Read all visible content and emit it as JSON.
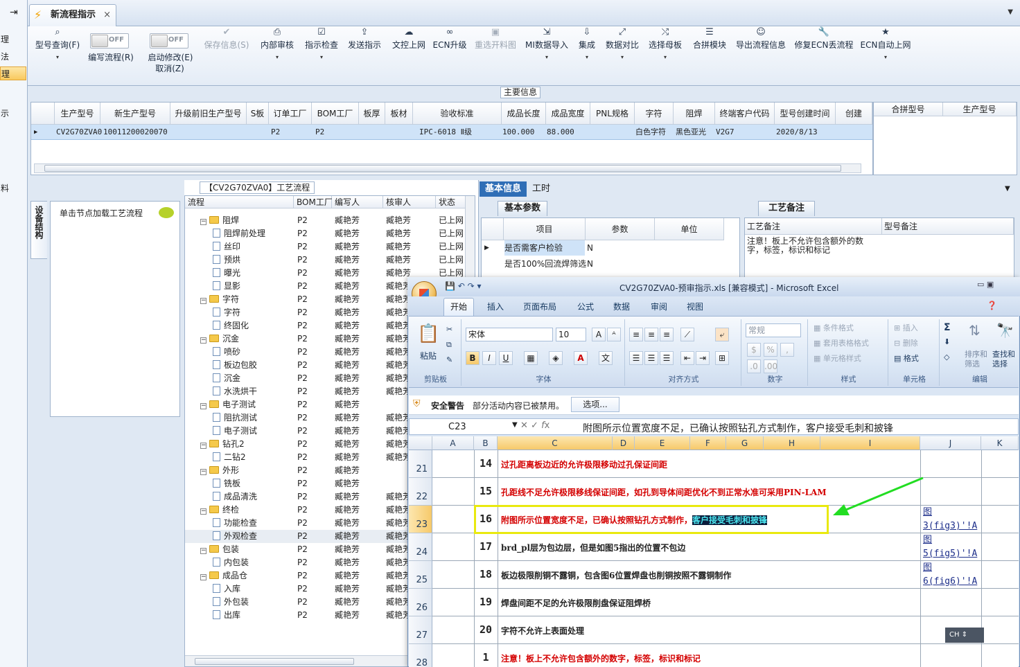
{
  "left_panel": {
    "items": [
      "理",
      "法",
      "理",
      "示",
      "料"
    ]
  },
  "tabbar": {
    "tab_title": "新流程指示",
    "close": "×"
  },
  "toolbar": {
    "items": [
      {
        "label": "型号查询(F)",
        "icon": "search-icon"
      },
      {
        "label": "编写流程(R)",
        "icon": "toggle"
      },
      {
        "label": "启动修改(E)",
        "icon": "toggle"
      },
      {
        "label": "取消(Z)",
        "icon": ""
      },
      {
        "label": "保存信息(S)",
        "icon": "check-icon"
      },
      {
        "label": "内部审核",
        "icon": "printer-icon"
      },
      {
        "label": "指示检查",
        "icon": "checkbox-icon"
      },
      {
        "label": "发送指示",
        "icon": "upload-icon"
      },
      {
        "label": "文控上网",
        "icon": "cloud-upload-icon"
      },
      {
        "label": "ECN升级",
        "icon": "binoculars-icon"
      },
      {
        "label": "重选开料图",
        "icon": "image-icon"
      },
      {
        "label": "MI数据导入",
        "icon": "import-icon"
      },
      {
        "label": "集成",
        "icon": "download-icon"
      },
      {
        "label": "数据对比",
        "icon": "compare-icon"
      },
      {
        "label": "选择母板",
        "icon": "shuffle-icon"
      },
      {
        "label": "合拼模块",
        "icon": "list-icon"
      },
      {
        "label": "导出流程信息",
        "icon": "smile-icon"
      },
      {
        "label": "修复ECN丢流程",
        "icon": "wrench-icon"
      },
      {
        "label": "ECN自动上网",
        "icon": "star-icon"
      }
    ],
    "toggle_text": "OFF"
  },
  "main_info": {
    "title": "主要信息",
    "columns": [
      "生产型号",
      "新生产型号",
      "升级前旧生产型号",
      "S板",
      "订单工厂",
      "BOM工厂",
      "板厚",
      "板材",
      "验收标准",
      "成品长度",
      "成品宽度",
      "PNL规格",
      "字符",
      "阻焊",
      "终端客户代码",
      "型号创建时间",
      "创建"
    ],
    "row": [
      "CV2G70ZVA0",
      "10011200020070",
      "",
      "",
      "P2",
      "P2",
      "",
      "",
      "IPC-6018 Ⅱ级",
      "100.000",
      "88.000",
      "",
      "白色字符",
      "黑色亚光",
      "V2G7",
      "2020/8/13",
      ""
    ],
    "side_columns": [
      "合拼型号",
      "生产型号"
    ]
  },
  "left_lower": {
    "vertical_tab": "设备结构",
    "hint": "单击节点加载工艺流程"
  },
  "process_tree": {
    "title": "【CV2G70ZVA0】工艺流程",
    "columns": [
      "流程",
      "BOM工厂",
      "编写人",
      "核审人",
      "状态"
    ],
    "rows": [
      {
        "name": "阻焊",
        "level": 0,
        "bom": "P2",
        "writer": "臧艳芳",
        "checker": "臧艳芳",
        "status": "已上网"
      },
      {
        "name": "阻焊前处理",
        "level": 1,
        "bom": "P2",
        "writer": "臧艳芳",
        "checker": "臧艳芳",
        "status": "已上网"
      },
      {
        "name": "丝印",
        "level": 1,
        "bom": "P2",
        "writer": "臧艳芳",
        "checker": "臧艳芳",
        "status": "已上网"
      },
      {
        "name": "预烘",
        "level": 1,
        "bom": "P2",
        "writer": "臧艳芳",
        "checker": "臧艳芳",
        "status": "已上网"
      },
      {
        "name": "曝光",
        "level": 1,
        "bom": "P2",
        "writer": "臧艳芳",
        "checker": "臧艳芳",
        "status": "已上网"
      },
      {
        "name": "显影",
        "level": 1,
        "bom": "P2",
        "writer": "臧艳芳",
        "checker": "臧艳芳",
        "status": ""
      },
      {
        "name": "字符",
        "level": 0,
        "bom": "P2",
        "writer": "臧艳芳",
        "checker": "臧艳芳",
        "status": ""
      },
      {
        "name": "字符",
        "level": 1,
        "bom": "P2",
        "writer": "臧艳芳",
        "checker": "臧艳芳",
        "status": ""
      },
      {
        "name": "终固化",
        "level": 1,
        "bom": "P2",
        "writer": "臧艳芳",
        "checker": "臧艳芳",
        "status": ""
      },
      {
        "name": "沉金",
        "level": 0,
        "bom": "P2",
        "writer": "臧艳芳",
        "checker": "臧艳芳",
        "status": ""
      },
      {
        "name": "喷砂",
        "level": 1,
        "bom": "P2",
        "writer": "臧艳芳",
        "checker": "臧艳芳",
        "status": ""
      },
      {
        "name": "板边包胶",
        "level": 1,
        "bom": "P2",
        "writer": "臧艳芳",
        "checker": "臧艳芳",
        "status": ""
      },
      {
        "name": "沉金",
        "level": 1,
        "bom": "P2",
        "writer": "臧艳芳",
        "checker": "臧艳芳",
        "status": ""
      },
      {
        "name": "水洗烘干",
        "level": 1,
        "bom": "P2",
        "writer": "臧艳芳",
        "checker": "臧艳芳",
        "status": ""
      },
      {
        "name": "电子测试",
        "level": 0,
        "bom": "P2",
        "writer": "臧艳芳",
        "checker": "",
        "status": ""
      },
      {
        "name": "阻抗测试",
        "level": 1,
        "bom": "P2",
        "writer": "臧艳芳",
        "checker": "臧艳芳",
        "status": ""
      },
      {
        "name": "电子测试",
        "level": 1,
        "bom": "P2",
        "writer": "臧艳芳",
        "checker": "臧艳芳",
        "status": ""
      },
      {
        "name": "钻孔2",
        "level": 0,
        "bom": "P2",
        "writer": "臧艳芳",
        "checker": "臧艳芳",
        "status": ""
      },
      {
        "name": "二钻2",
        "level": 1,
        "bom": "P2",
        "writer": "臧艳芳",
        "checker": "臧艳芳",
        "status": ""
      },
      {
        "name": "外形",
        "level": 0,
        "bom": "P2",
        "writer": "臧艳芳",
        "checker": "",
        "status": ""
      },
      {
        "name": "铣板",
        "level": 1,
        "bom": "P2",
        "writer": "臧艳芳",
        "checker": "",
        "status": ""
      },
      {
        "name": "成品清洗",
        "level": 1,
        "bom": "P2",
        "writer": "臧艳芳",
        "checker": "臧艳芳",
        "status": ""
      },
      {
        "name": "终检",
        "level": 0,
        "bom": "P2",
        "writer": "臧艳芳",
        "checker": "臧艳芳",
        "status": ""
      },
      {
        "name": "功能检查",
        "level": 1,
        "bom": "P2",
        "writer": "臧艳芳",
        "checker": "臧艳芳",
        "status": ""
      },
      {
        "name": "外观检查",
        "level": 1,
        "bom": "P2",
        "writer": "臧艳芳",
        "checker": "臧艳芳",
        "status": ""
      },
      {
        "name": "包装",
        "level": 0,
        "bom": "P2",
        "writer": "臧艳芳",
        "checker": "臧艳芳",
        "status": ""
      },
      {
        "name": "内包装",
        "level": 1,
        "bom": "P2",
        "writer": "臧艳芳",
        "checker": "臧艳芳",
        "status": ""
      },
      {
        "name": "成品仓",
        "level": 0,
        "bom": "P2",
        "writer": "臧艳芳",
        "checker": "臧艳芳",
        "status": ""
      },
      {
        "name": "入库",
        "level": 1,
        "bom": "P2",
        "writer": "臧艳芳",
        "checker": "臧艳芳",
        "status": ""
      },
      {
        "name": "外包装",
        "level": 1,
        "bom": "P2",
        "writer": "臧艳芳",
        "checker": "臧艳芳",
        "status": ""
      },
      {
        "name": "出库",
        "level": 1,
        "bom": "P2",
        "writer": "臧艳芳",
        "checker": "臧艳芳",
        "status": ""
      }
    ]
  },
  "right_panel": {
    "tabs": [
      "基本信息",
      "工时"
    ],
    "params_tab": "基本参数",
    "param_columns": [
      "项目",
      "参数",
      "单位"
    ],
    "params": [
      {
        "item": "是否需客户检验",
        "value": "N",
        "unit": ""
      },
      {
        "item": "是否100%回流焊筛选",
        "value": "N",
        "unit": ""
      }
    ],
    "notes_tab": "工艺备注",
    "note_columns": [
      "工艺备注",
      "型号备注"
    ],
    "note_text": "注意！板上不允许包含额外的数字，标签，标识和标记"
  },
  "excel": {
    "title": "CV2G70ZVA0-预审指示.xls  [兼容模式] - Microsoft Excel",
    "tabs": [
      "开始",
      "插入",
      "页面布局",
      "公式",
      "数据",
      "审阅",
      "视图"
    ],
    "font_name": "宋体",
    "font_size": "10",
    "number_format": "常规",
    "groups": [
      "剪贴板",
      "字体",
      "对齐方式",
      "数字",
      "样式",
      "单元格",
      "编辑"
    ],
    "ribbon_labels": {
      "paste": "粘贴",
      "cond_format": "条件格式",
      "table_format": "套用表格格式",
      "cell_style": "单元格样式",
      "insert": "插入",
      "delete": "删除",
      "format": "格式",
      "sort": "排序和\n筛选",
      "find": "查找和\n选择"
    },
    "security_label": "安全警告",
    "security_text": "部分活动内容已被禁用。",
    "options_button": "选项...",
    "name_box": "C23",
    "formula": "附图所示位置宽度不足，已确认按照钻孔方式制作，客户接受毛刺和披锋",
    "columns": [
      "A",
      "B",
      "C",
      "D",
      "E",
      "F",
      "G",
      "H",
      "I",
      "J",
      "K"
    ],
    "rows": [
      {
        "rownum": "21",
        "num": "14",
        "text": "过孔距离板边近的允许极限移动过孔保证间距",
        "highlight": "",
        "red": true,
        "link": ""
      },
      {
        "rownum": "22",
        "num": "15",
        "text": "孔距线不足允许极限移线保证间距，如孔到导体间距优化不到正常水准可采用PIN-LAM",
        "highlight": "",
        "red": true,
        "link": ""
      },
      {
        "rownum": "23",
        "num": "16",
        "text": "附图所示位置宽度不足，已确认按照钻孔方式制作，",
        "highlight": "客户接受毛刺和披锋",
        "red": true,
        "link": "图\n3(fig3)'!A"
      },
      {
        "rownum": "24",
        "num": "17",
        "text": "brd_pl层为包边层，但是如图5指出的位置不包边",
        "highlight": "",
        "red": false,
        "link": "图\n5(fig5)'!A"
      },
      {
        "rownum": "25",
        "num": "18",
        "text": "板边极限削铜不露铜，包含图6位置焊盘也削铜按照不露铜制作",
        "highlight": "",
        "red": false,
        "link": "图\n6(fig6)'!A"
      },
      {
        "rownum": "26",
        "num": "19",
        "text": "焊盘间距不足的允许极限削盘保证阻焊桥",
        "highlight": "",
        "red": false,
        "link": ""
      },
      {
        "rownum": "27",
        "num": "20",
        "text": "字符不允许上表面处理",
        "highlight": "",
        "red": false,
        "link": ""
      },
      {
        "rownum": "28",
        "num": "1",
        "text": "注意！板上不允许包含额外的数字，标签，标识和标记",
        "highlight": "",
        "red": true,
        "link": ""
      }
    ],
    "ime": "CH"
  }
}
